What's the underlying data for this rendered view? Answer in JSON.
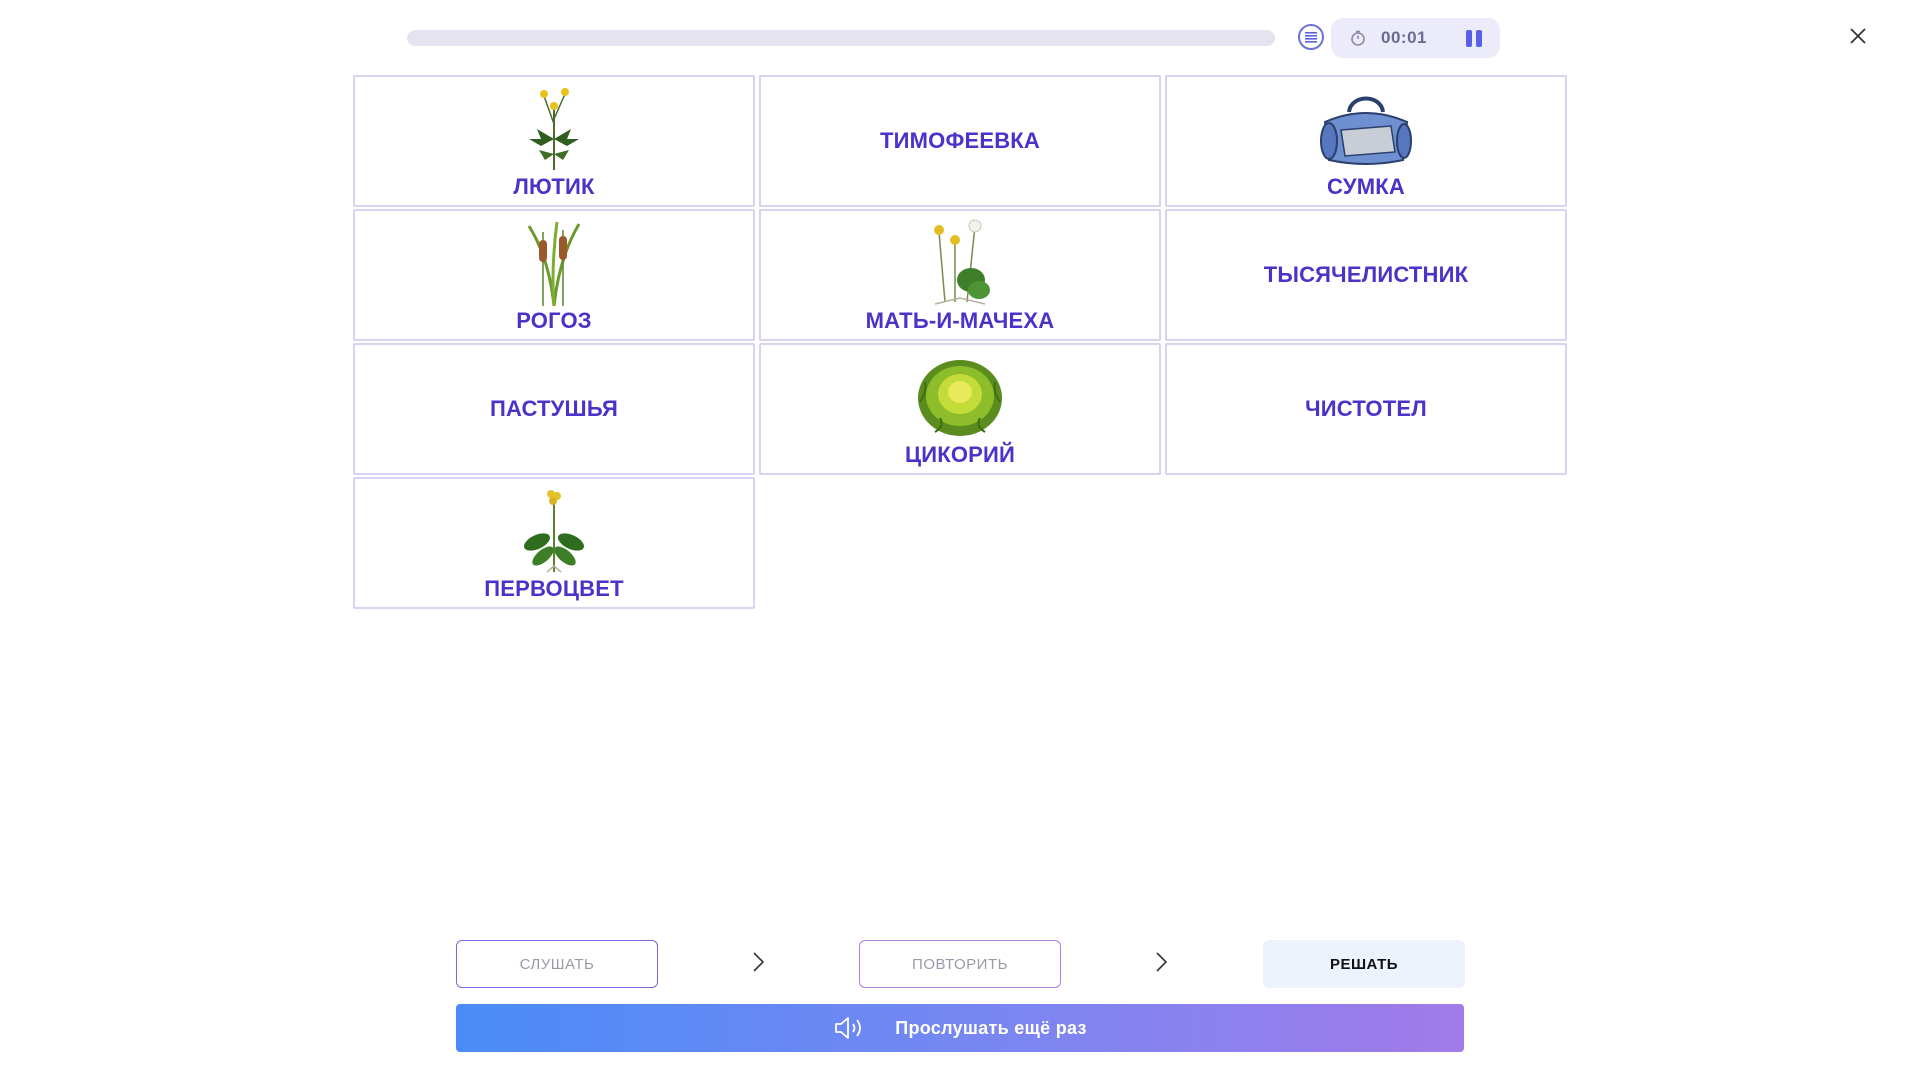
{
  "top_bar": {
    "progress": 0,
    "timer": "00:01",
    "list_icon": "list-icon",
    "timer_icon": "stopwatch-icon",
    "pause_icon": "pause-icon",
    "close_icon": "close-icon"
  },
  "cards": [
    {
      "label": "ЛЮТИК",
      "image": "buttercup-plant"
    },
    {
      "label": "ТИМОФЕЕВКА",
      "image": null
    },
    {
      "label": "СУМКА",
      "image": "duffel-bag"
    },
    {
      "label": "РОГОЗ",
      "image": "cattail-plant"
    },
    {
      "label": "МАТЬ-И-МАЧЕХА",
      "image": "coltsfoot-plant"
    },
    {
      "label": "ТЫСЯЧЕЛИСТНИК",
      "image": null
    },
    {
      "label": "ПАСТУШЬЯ",
      "image": null
    },
    {
      "label": "ЦИКОРИЙ",
      "image": "chicory-lettuce"
    },
    {
      "label": "ЧИСТОТЕЛ",
      "image": null
    },
    {
      "label": "ПЕРВОЦВЕТ",
      "image": "primrose-plant"
    }
  ],
  "steps": {
    "listen": "СЛУШАТЬ",
    "repeat": "ПОВТОРИТЬ",
    "solve": "РЕШАТЬ"
  },
  "replay": {
    "label": "Прослушать ещё раз",
    "icon": "speaker-icon"
  },
  "colors": {
    "accent": "#4a33c8",
    "card_border": "#d7d3f0",
    "gradient_start": "#4a8cf7",
    "gradient_end": "#a17be9"
  }
}
